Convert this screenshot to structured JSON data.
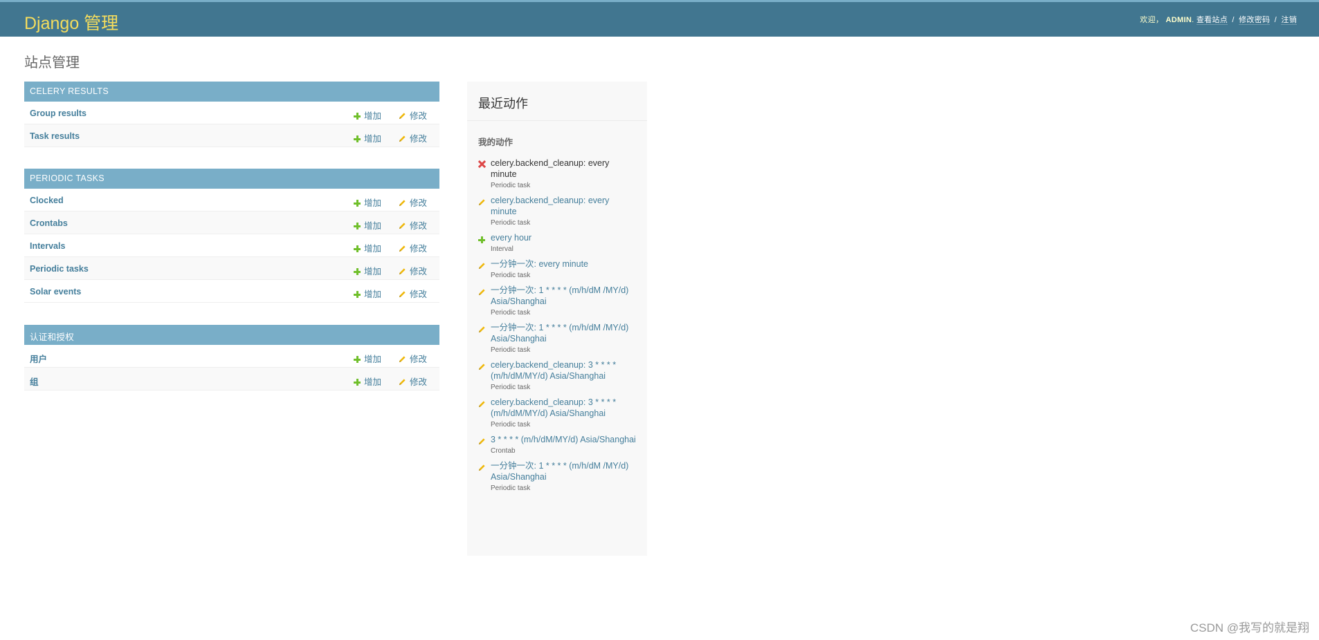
{
  "header": {
    "brand": "Django 管理",
    "welcome": "欢迎，",
    "username": "ADMIN",
    "view_site": "查看站点",
    "change_password": "修改密码",
    "logout": "注销",
    "separator": "/"
  },
  "page_title": "站点管理",
  "action_labels": {
    "add": "增加",
    "change": "修改"
  },
  "modules": [
    {
      "caption": "CELERY RESULTS",
      "models": [
        "Group results",
        "Task results"
      ]
    },
    {
      "caption": "PERIODIC TASKS",
      "models": [
        "Clocked",
        "Crontabs",
        "Intervals",
        "Periodic tasks",
        "Solar events"
      ]
    },
    {
      "caption": "认证和授权",
      "models": [
        "用户",
        "组"
      ]
    }
  ],
  "recent_actions": {
    "title": "最近动作",
    "subtitle": "我的动作",
    "items": [
      {
        "kind": "delete",
        "text": "celery.backend_cleanup: every minute",
        "type": "Periodic task"
      },
      {
        "kind": "change",
        "text": "celery.backend_cleanup: every minute",
        "type": "Periodic task"
      },
      {
        "kind": "add",
        "text": "every hour",
        "type": "Interval"
      },
      {
        "kind": "change",
        "text": "一分钟一次: every minute",
        "type": "Periodic task"
      },
      {
        "kind": "change",
        "text": "一分钟一次: 1 * * * * (m/h/dM /MY/d) Asia/Shanghai",
        "type": "Periodic task"
      },
      {
        "kind": "change",
        "text": "一分钟一次: 1 * * * * (m/h/dM /MY/d) Asia/Shanghai",
        "type": "Periodic task"
      },
      {
        "kind": "change",
        "text": "celery.backend_cleanup: 3 * * * * (m/h/dM/MY/d) Asia/Shanghai",
        "type": "Periodic task"
      },
      {
        "kind": "change",
        "text": "celery.backend_cleanup: 3 * * * * (m/h/dM/MY/d) Asia/Shanghai",
        "type": "Periodic task"
      },
      {
        "kind": "change",
        "text": "3 * * * * (m/h/dM/MY/d) Asia/Shanghai",
        "type": "Crontab"
      },
      {
        "kind": "change",
        "text": "一分钟一次: 1 * * * * (m/h/dM /MY/d) Asia/Shanghai",
        "type": "Periodic task"
      }
    ]
  },
  "watermark": "CSDN @我写的就是翔",
  "colors": {
    "header_bg": "#417690",
    "brand": "#f5dd5d",
    "caption_bg": "#79aec8",
    "link": "#447e9b",
    "add_green": "#70bf2b",
    "change_yellow": "#efb80b",
    "delete_red": "#dd4646"
  }
}
